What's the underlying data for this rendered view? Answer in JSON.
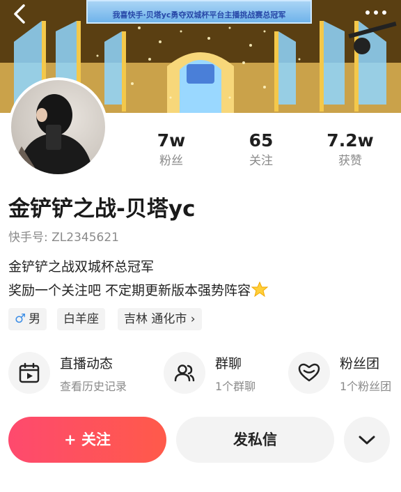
{
  "banner": {
    "caption": "我喜快手·贝塔yc勇夺双城杯平台主播挑战赛总冠军",
    "icons": {
      "back": "back-arrow-icon",
      "more": "more-dots-icon"
    }
  },
  "stats": [
    {
      "value": "7w",
      "label": "粉丝"
    },
    {
      "value": "65",
      "label": "关注"
    },
    {
      "value": "7.2w",
      "label": "获赞"
    }
  ],
  "profile": {
    "name": "金铲铲之战-贝塔yc",
    "user_id": "快手号: ZL2345621",
    "bio_line1": "金铲铲之战双城杯总冠军",
    "bio_line2": "奖励一个关注吧 不定期更新版本强势阵容"
  },
  "tags": {
    "gender_symbol": "♂",
    "gender": "男",
    "zodiac": "白羊座",
    "location": "吉林 通化市 ›"
  },
  "entries": [
    {
      "title": "直播动态",
      "subtitle": "查看历史记录",
      "icon": "calendar-play-icon"
    },
    {
      "title": "群聊",
      "subtitle": "1个群聊",
      "icon": "group-users-icon"
    },
    {
      "title": "粉丝团",
      "subtitle": "1个粉丝团",
      "icon": "heart-badge-icon"
    }
  ],
  "actions": {
    "follow": "+ 关注",
    "message": "发私信",
    "dropdown_icon": "chevron-down-icon"
  },
  "colors": {
    "accent": "#fe4a6e",
    "male": "#3d8ee6",
    "muted_text": "#8a8a8a"
  }
}
